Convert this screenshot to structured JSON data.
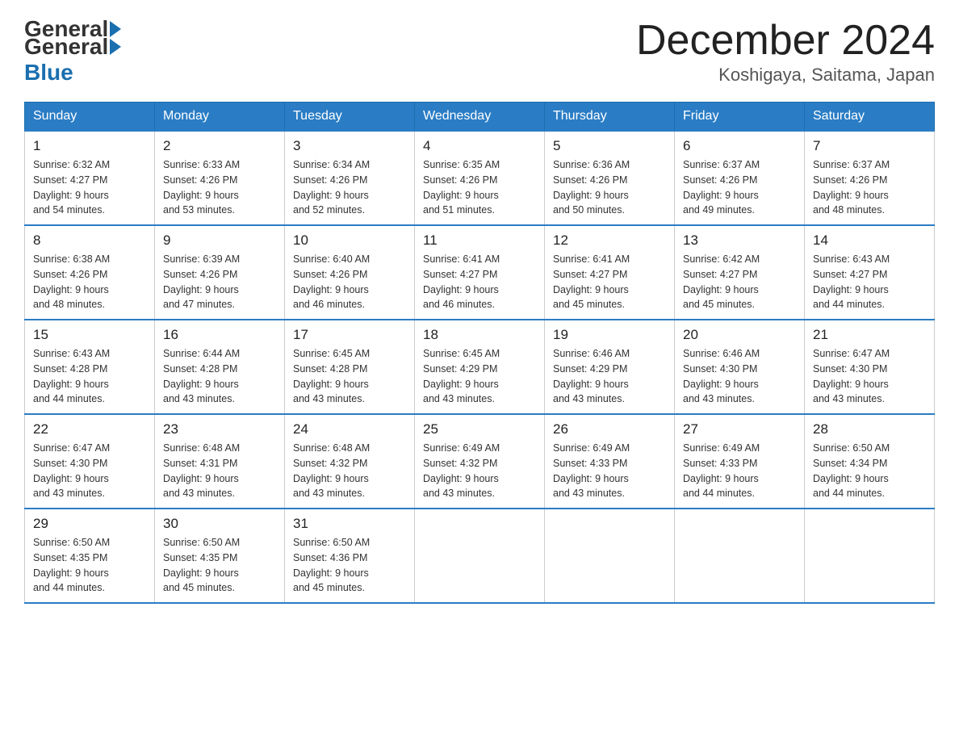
{
  "header": {
    "logo_general": "General",
    "logo_blue": "Blue",
    "month_title": "December 2024",
    "location": "Koshigaya, Saitama, Japan"
  },
  "days_of_week": [
    "Sunday",
    "Monday",
    "Tuesday",
    "Wednesday",
    "Thursday",
    "Friday",
    "Saturday"
  ],
  "weeks": [
    [
      {
        "day": "1",
        "sunrise": "6:32 AM",
        "sunset": "4:27 PM",
        "daylight": "9 hours and 54 minutes."
      },
      {
        "day": "2",
        "sunrise": "6:33 AM",
        "sunset": "4:26 PM",
        "daylight": "9 hours and 53 minutes."
      },
      {
        "day": "3",
        "sunrise": "6:34 AM",
        "sunset": "4:26 PM",
        "daylight": "9 hours and 52 minutes."
      },
      {
        "day": "4",
        "sunrise": "6:35 AM",
        "sunset": "4:26 PM",
        "daylight": "9 hours and 51 minutes."
      },
      {
        "day": "5",
        "sunrise": "6:36 AM",
        "sunset": "4:26 PM",
        "daylight": "9 hours and 50 minutes."
      },
      {
        "day": "6",
        "sunrise": "6:37 AM",
        "sunset": "4:26 PM",
        "daylight": "9 hours and 49 minutes."
      },
      {
        "day": "7",
        "sunrise": "6:37 AM",
        "sunset": "4:26 PM",
        "daylight": "9 hours and 48 minutes."
      }
    ],
    [
      {
        "day": "8",
        "sunrise": "6:38 AM",
        "sunset": "4:26 PM",
        "daylight": "9 hours and 48 minutes."
      },
      {
        "day": "9",
        "sunrise": "6:39 AM",
        "sunset": "4:26 PM",
        "daylight": "9 hours and 47 minutes."
      },
      {
        "day": "10",
        "sunrise": "6:40 AM",
        "sunset": "4:26 PM",
        "daylight": "9 hours and 46 minutes."
      },
      {
        "day": "11",
        "sunrise": "6:41 AM",
        "sunset": "4:27 PM",
        "daylight": "9 hours and 46 minutes."
      },
      {
        "day": "12",
        "sunrise": "6:41 AM",
        "sunset": "4:27 PM",
        "daylight": "9 hours and 45 minutes."
      },
      {
        "day": "13",
        "sunrise": "6:42 AM",
        "sunset": "4:27 PM",
        "daylight": "9 hours and 45 minutes."
      },
      {
        "day": "14",
        "sunrise": "6:43 AM",
        "sunset": "4:27 PM",
        "daylight": "9 hours and 44 minutes."
      }
    ],
    [
      {
        "day": "15",
        "sunrise": "6:43 AM",
        "sunset": "4:28 PM",
        "daylight": "9 hours and 44 minutes."
      },
      {
        "day": "16",
        "sunrise": "6:44 AM",
        "sunset": "4:28 PM",
        "daylight": "9 hours and 43 minutes."
      },
      {
        "day": "17",
        "sunrise": "6:45 AM",
        "sunset": "4:28 PM",
        "daylight": "9 hours and 43 minutes."
      },
      {
        "day": "18",
        "sunrise": "6:45 AM",
        "sunset": "4:29 PM",
        "daylight": "9 hours and 43 minutes."
      },
      {
        "day": "19",
        "sunrise": "6:46 AM",
        "sunset": "4:29 PM",
        "daylight": "9 hours and 43 minutes."
      },
      {
        "day": "20",
        "sunrise": "6:46 AM",
        "sunset": "4:30 PM",
        "daylight": "9 hours and 43 minutes."
      },
      {
        "day": "21",
        "sunrise": "6:47 AM",
        "sunset": "4:30 PM",
        "daylight": "9 hours and 43 minutes."
      }
    ],
    [
      {
        "day": "22",
        "sunrise": "6:47 AM",
        "sunset": "4:30 PM",
        "daylight": "9 hours and 43 minutes."
      },
      {
        "day": "23",
        "sunrise": "6:48 AM",
        "sunset": "4:31 PM",
        "daylight": "9 hours and 43 minutes."
      },
      {
        "day": "24",
        "sunrise": "6:48 AM",
        "sunset": "4:32 PM",
        "daylight": "9 hours and 43 minutes."
      },
      {
        "day": "25",
        "sunrise": "6:49 AM",
        "sunset": "4:32 PM",
        "daylight": "9 hours and 43 minutes."
      },
      {
        "day": "26",
        "sunrise": "6:49 AM",
        "sunset": "4:33 PM",
        "daylight": "9 hours and 43 minutes."
      },
      {
        "day": "27",
        "sunrise": "6:49 AM",
        "sunset": "4:33 PM",
        "daylight": "9 hours and 44 minutes."
      },
      {
        "day": "28",
        "sunrise": "6:50 AM",
        "sunset": "4:34 PM",
        "daylight": "9 hours and 44 minutes."
      }
    ],
    [
      {
        "day": "29",
        "sunrise": "6:50 AM",
        "sunset": "4:35 PM",
        "daylight": "9 hours and 44 minutes."
      },
      {
        "day": "30",
        "sunrise": "6:50 AM",
        "sunset": "4:35 PM",
        "daylight": "9 hours and 45 minutes."
      },
      {
        "day": "31",
        "sunrise": "6:50 AM",
        "sunset": "4:36 PM",
        "daylight": "9 hours and 45 minutes."
      },
      null,
      null,
      null,
      null
    ]
  ],
  "labels": {
    "sunrise": "Sunrise:",
    "sunset": "Sunset:",
    "daylight": "Daylight:"
  }
}
